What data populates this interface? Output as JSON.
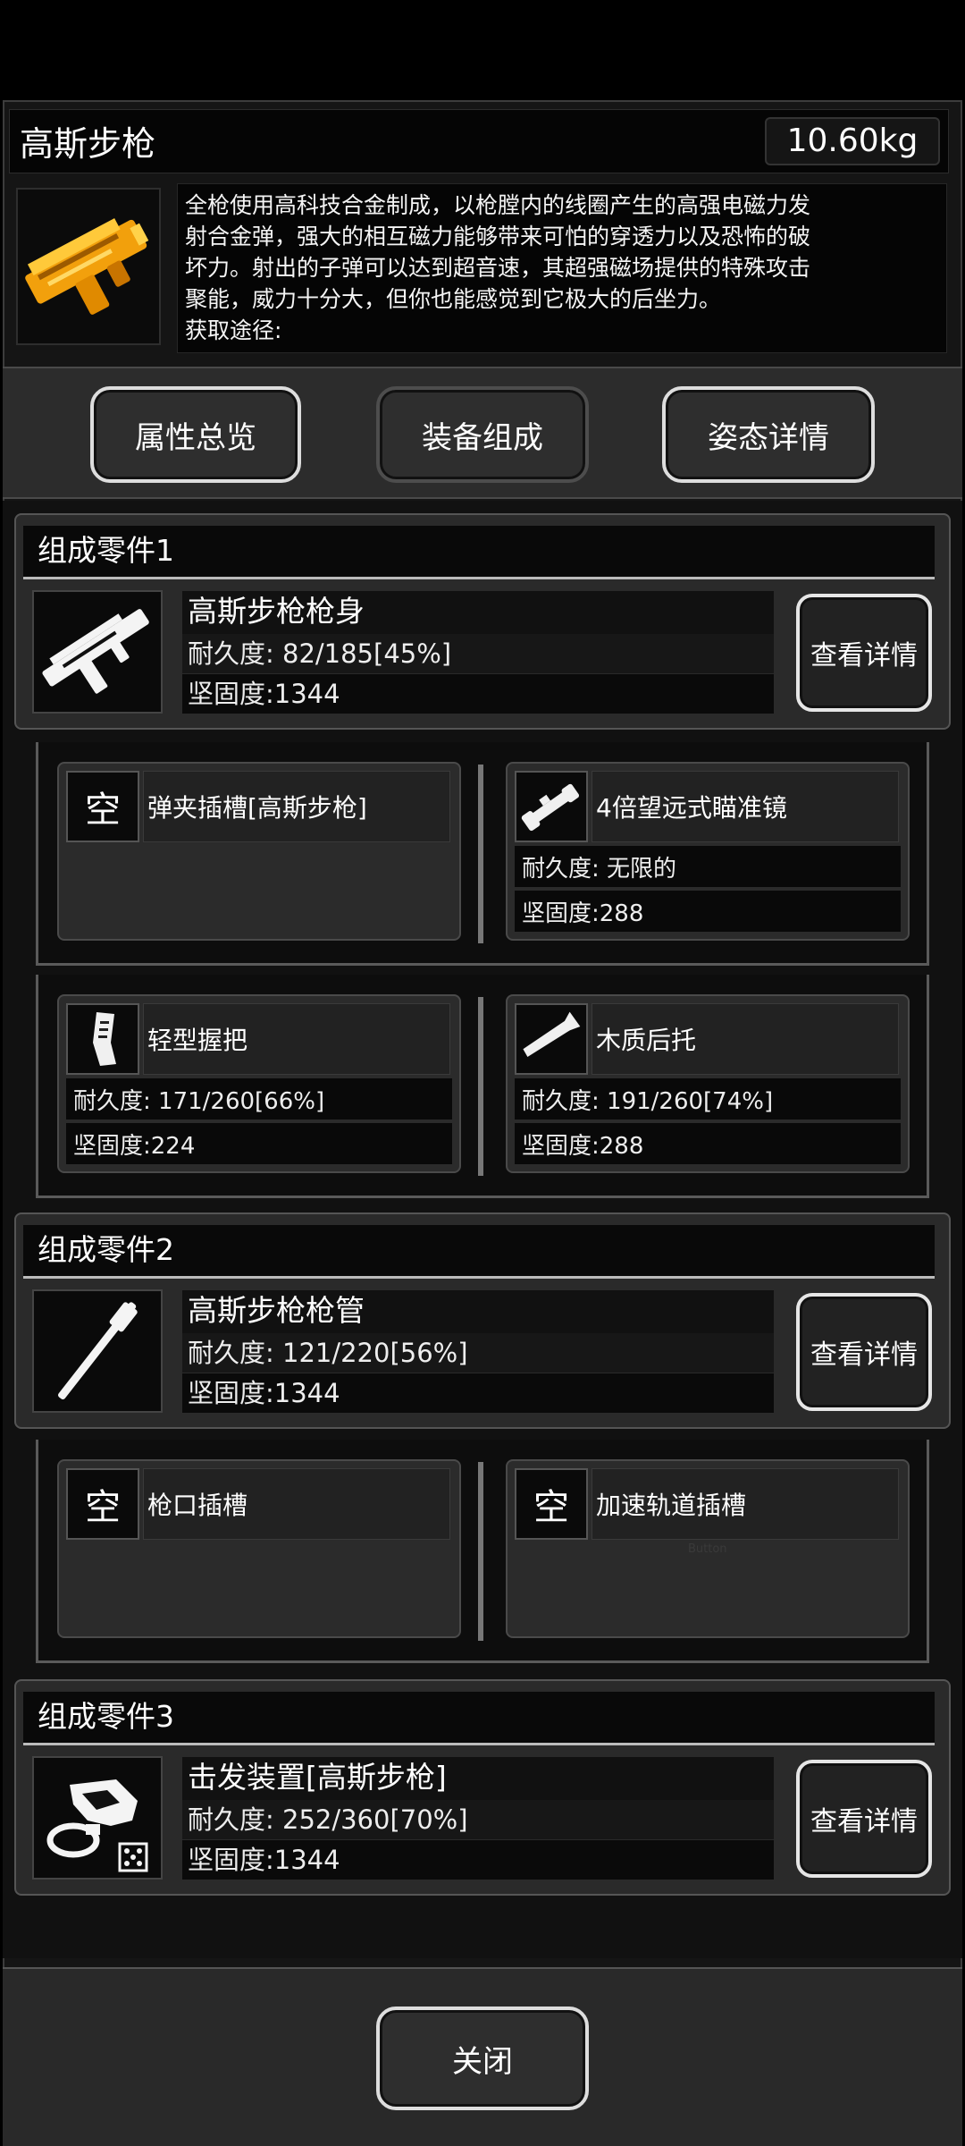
{
  "weapon": {
    "name": "高斯步枪",
    "weight": "10.60kg",
    "description": [
      "全枪使用高科技合金制成，以枪膛内的线圈产生的高强电磁力发",
      "射合金弹，强大的相互磁力能够带来可怕的穿透力以及恐怖的破",
      "坏力。射出的子弹可以达到超音速，其超强磁场提供的特殊攻击",
      "聚能，威力十分大，但你也能感觉到它极大的后坐力。",
      "获取途径:"
    ],
    "icon": "golden-gauss-rifle-icon"
  },
  "tabs": [
    "属性总览",
    "装备组成",
    "姿态详情"
  ],
  "active_tab": "装备组成",
  "components": [
    {
      "title": "组成零件1",
      "part": {
        "name": "高斯步枪枪身",
        "durability": "耐久度:  82/185[45%]",
        "hardness": "坚固度:1344",
        "icon": "rifle-body-icon"
      },
      "detail_label": "查看详情",
      "slots": [
        {
          "empty_label": "空",
          "name": "弹夹插槽[高斯步枪]"
        },
        {
          "name": "4倍望远式瞄准镜",
          "durability": "耐久度:  无限的",
          "hardness": "坚固度:288",
          "icon": "scope-icon"
        },
        {
          "name": "轻型握把",
          "durability": "耐久度:  171/260[66%]",
          "hardness": "坚固度:224",
          "icon": "grip-icon"
        },
        {
          "name": "木质后托",
          "durability": "耐久度:  191/260[74%]",
          "hardness": "坚固度:288",
          "icon": "stock-icon"
        }
      ]
    },
    {
      "title": "组成零件2",
      "part": {
        "name": "高斯步枪枪管",
        "durability": "耐久度:  121/220[56%]",
        "hardness": "坚固度:1344",
        "icon": "barrel-icon"
      },
      "detail_label": "查看详情",
      "slots": [
        {
          "empty_label": "空",
          "name": "枪口插槽"
        },
        {
          "empty_label": "空",
          "name": "加速轨道插槽",
          "faint": "Button"
        }
      ]
    },
    {
      "title": "组成零件3",
      "part": {
        "name": "击发装置[高斯步枪]",
        "durability": "耐久度:  252/360[70%]",
        "hardness": "坚固度:1344",
        "icon": "firing-mechanism-icon"
      },
      "detail_label": "查看详情"
    }
  ],
  "close_label": "关闭"
}
